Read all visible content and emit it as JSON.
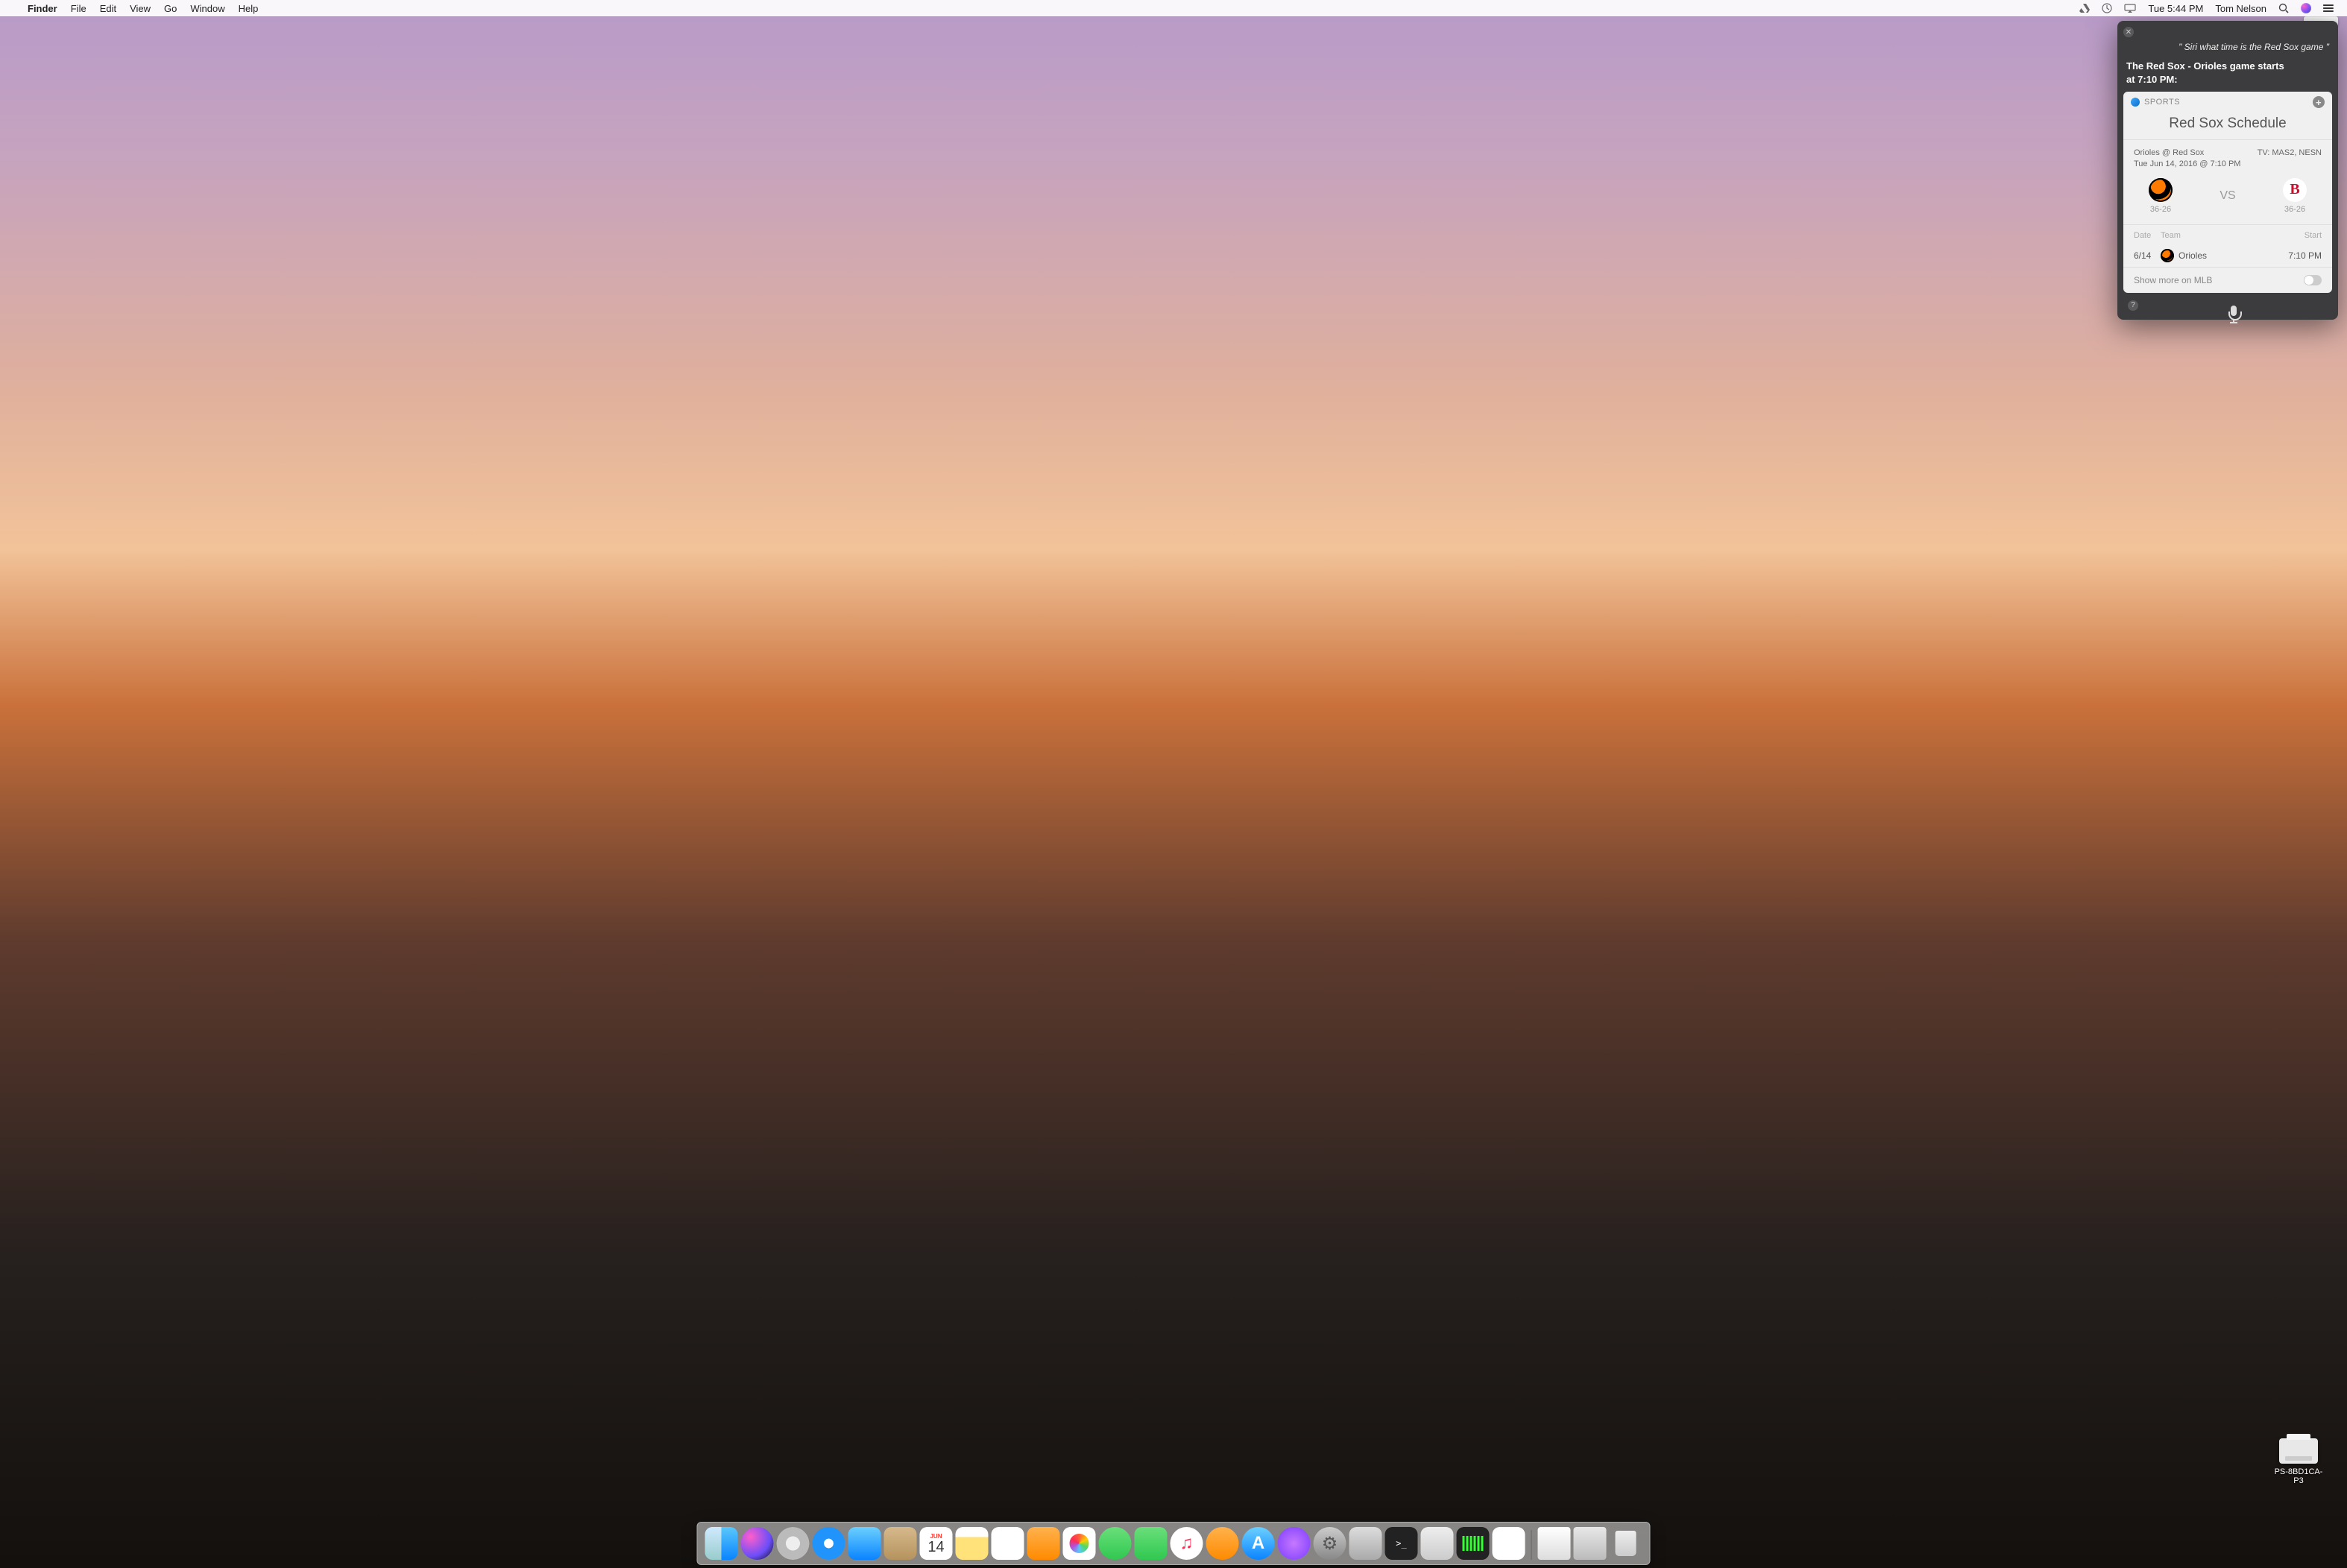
{
  "menubar": {
    "app": "Finder",
    "items": [
      "File",
      "Edit",
      "View",
      "Go",
      "Window",
      "Help"
    ],
    "clock": "Tue 5:44 PM",
    "user": "Tom Nelson"
  },
  "desktop": {
    "printer_label": "PS-8BD1CA-P3"
  },
  "siri": {
    "query": "\" Siri what time is the Red Sox game \"",
    "answer_line1": "The Red Sox - Orioles game starts",
    "answer_line2": "at 7:10 PM:",
    "card": {
      "section": "SPORTS",
      "title": "Red Sox Schedule",
      "matchup_title": "Orioles @ Red Sox",
      "matchup_time": "Tue Jun 14, 2016 @ 7:10 PM",
      "tv": "TV: MAS2, NESN",
      "away": {
        "record": "36-26"
      },
      "home": {
        "record": "36-26",
        "logo_letter": "B"
      },
      "vs": "VS",
      "cols": {
        "date": "Date",
        "team": "Team",
        "start": "Start"
      },
      "row": {
        "date": "6/14",
        "team": "Orioles",
        "start": "7:10 PM"
      },
      "more": "Show more on MLB"
    }
  },
  "dock": {
    "cal_month": "JUN",
    "cal_day": "14"
  }
}
